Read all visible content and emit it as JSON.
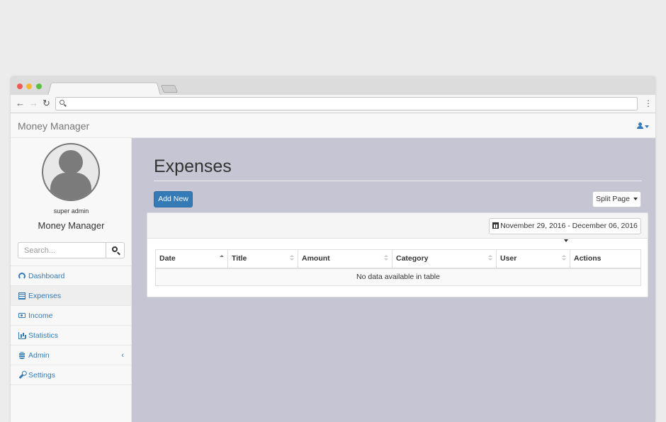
{
  "app": {
    "brand": "Money Manager"
  },
  "profile": {
    "role": "super admin",
    "app_name": "Money Manager"
  },
  "search": {
    "placeholder": "Search..."
  },
  "sidebar": {
    "items": [
      {
        "label": "Dashboard",
        "icon": "dashboard-icon"
      },
      {
        "label": "Expenses",
        "icon": "table-icon",
        "active": true
      },
      {
        "label": "Income",
        "icon": "money-icon"
      },
      {
        "label": "Statistics",
        "icon": "bar-chart-icon"
      },
      {
        "label": "Admin",
        "icon": "database-icon",
        "expand": "‹"
      },
      {
        "label": "Settings",
        "icon": "wrench-icon"
      }
    ]
  },
  "page": {
    "title": "Expenses",
    "add_button": "Add New",
    "split_button": "Split Page",
    "date_range": "November 29, 2016 - December 06, 2016"
  },
  "table": {
    "columns": [
      "Date",
      "Title",
      "Amount",
      "Category",
      "User",
      "Actions"
    ],
    "empty_message": "No data available in table"
  },
  "colors": {
    "primary": "#337ab7",
    "content_bg": "#c5c5d3",
    "sidebar_bg": "#f8f8f8"
  }
}
